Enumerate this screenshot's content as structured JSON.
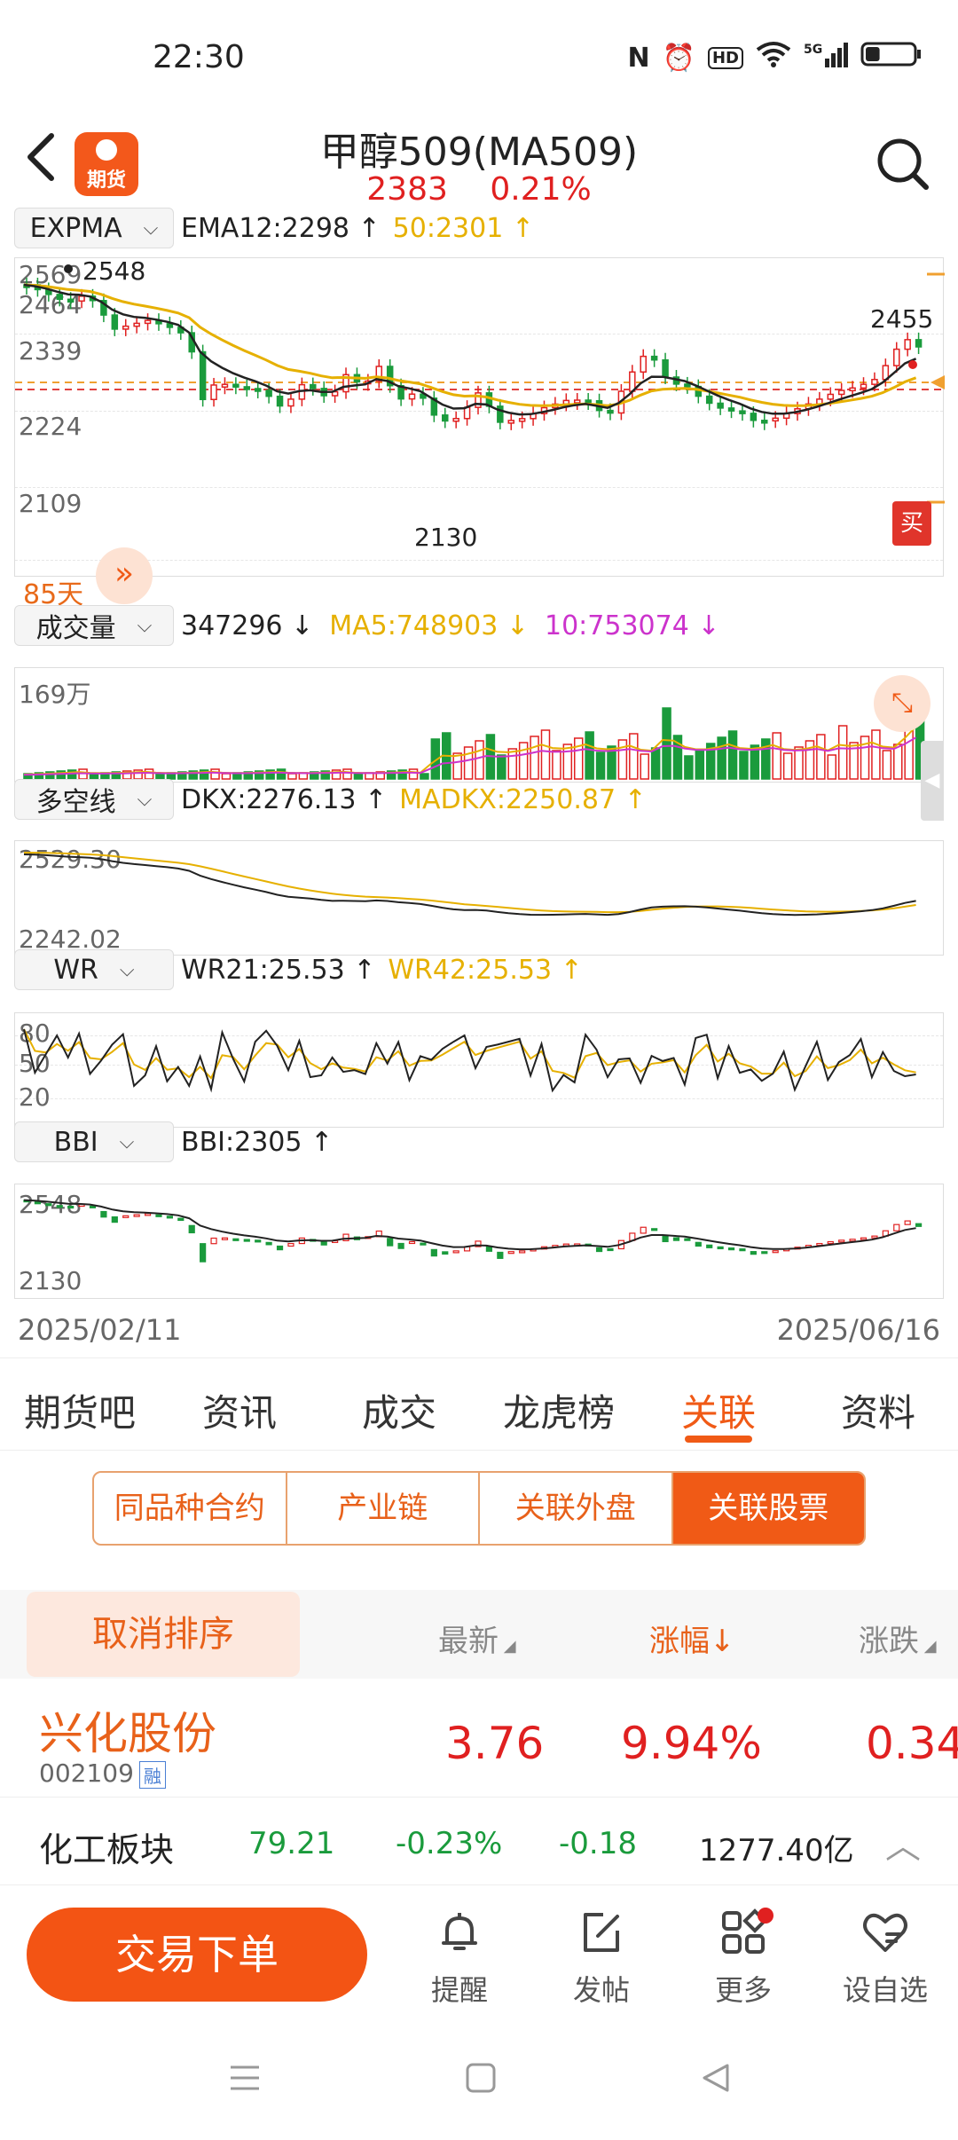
{
  "status": {
    "time": "22:30",
    "battery_fraction": 0.3
  },
  "header": {
    "title": "甲醇509(MA509)",
    "price": "2383",
    "change_pct": "0.21%"
  },
  "kline": {
    "indicator": "EXPMA",
    "line1": "EMA12:2298 ↑",
    "line2": "50:2301 ↑",
    "y_labels": [
      "2569",
      "2464",
      "2339",
      "2224",
      "2109"
    ],
    "high_label": "2548",
    "low_label": "2130",
    "last_label": "2455",
    "days": "85天",
    "buy_tag": "买"
  },
  "volume": {
    "indicator": "成交量",
    "v": "347296 ↓",
    "ma5": "MA5:748903 ↓",
    "ma10": "10:753074 ↓",
    "y_label": "169万"
  },
  "dkx": {
    "indicator": "多空线",
    "v1": "DKX:2276.13 ↑",
    "v2": "MADKX:2250.87 ↑",
    "y_top": "2529.30",
    "y_bot": "2242.02"
  },
  "wr": {
    "indicator": "WR",
    "v1": "WR21:25.53 ↑",
    "v2": "WR42:25.53 ↑",
    "levels": [
      "80",
      "50",
      "20"
    ]
  },
  "bbi": {
    "indicator": "BBI",
    "v1": "BBI:2305 ↑",
    "y_top": "2548",
    "y_bot": "2130"
  },
  "dates": {
    "start": "2025/02/11",
    "end": "2025/06/16"
  },
  "tabs": [
    "期货吧",
    "资讯",
    "成交",
    "龙虎榜",
    "关联",
    "资料"
  ],
  "segments": [
    "同品种合约",
    "产业链",
    "关联外盘",
    "关联股票"
  ],
  "table": {
    "cancel_sort": "取消排序",
    "headers": {
      "latest": "最新",
      "change_pct": "涨幅↓",
      "change": "涨跌"
    },
    "row": {
      "name": "兴化股份",
      "code": "002109",
      "tag": "融",
      "latest": "3.76",
      "change_pct": "9.94%",
      "change": "0.34"
    }
  },
  "sector": {
    "name": "化工板块",
    "value": "79.21",
    "pct": "-0.23%",
    "chg": "-0.18",
    "amount": "1277.40亿"
  },
  "actions": {
    "trade": "交易下单",
    "remind": "提醒",
    "post": "发帖",
    "more": "更多",
    "watch": "设自选"
  },
  "colors": {
    "accent": "#f05a16",
    "up": "#e02020",
    "down": "#1a9b3c",
    "ema_yellow": "#e6b000",
    "ma10_purple": "#cc33cc"
  }
}
